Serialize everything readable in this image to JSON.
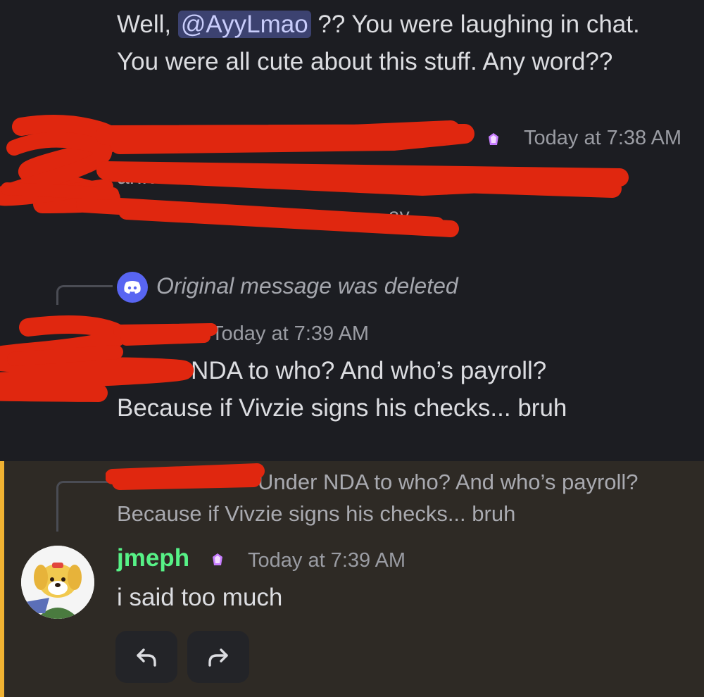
{
  "message1": {
    "line1_prefix": "Well, ",
    "mention": "@AyyLmao",
    "line1_suffix": " ?? You were laughing in chat.",
    "line2": "You were all cute about this stuff. Any word??"
  },
  "message2": {
    "timestamp": "Today at 7:38 AM",
    "redacted_fragments": [
      "anlv",
      "ay"
    ]
  },
  "deleted_reply": {
    "text": "Original message was deleted",
    "icon": "discord-icon"
  },
  "message3": {
    "timestamp": "Today at 7:39 AM",
    "line1": "Under NDA to who? And who’s payroll?",
    "line2": "Because if Vivzie signs his checks... bruh"
  },
  "reply_preview": {
    "line1": "Under NDA to who? And who’s payroll?",
    "line2": "Because if Vivzie signs his checks... bruh"
  },
  "message4": {
    "username": "jmeph",
    "timestamp": "Today at 7:39 AM",
    "text": "i said too much",
    "avatar": "isabelle-avatar",
    "username_color": "#57f287"
  },
  "actions": {
    "reply_icon": "reply-arrow-icon",
    "forward_icon": "forward-arrow-icon"
  },
  "colors": {
    "background": "#1c1d22",
    "highlight_background": "#2e2a25",
    "highlight_bar": "#f0b232",
    "mention_background": "#3c4270",
    "redaction": "#e0270f",
    "blurple": "#5865f2"
  }
}
